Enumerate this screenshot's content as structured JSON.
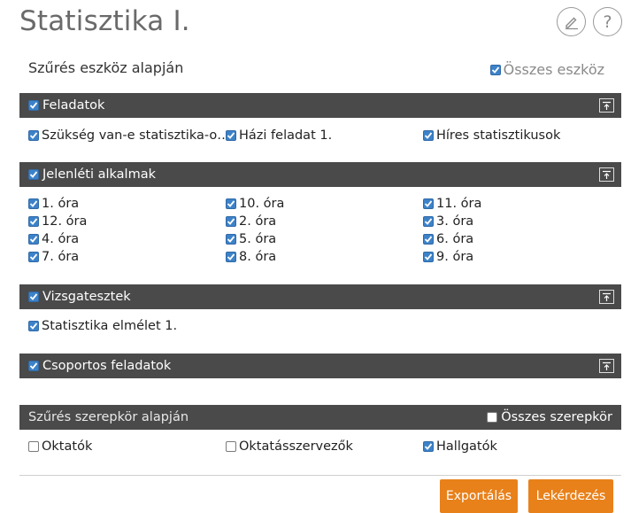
{
  "header": {
    "title": "Statisztika I."
  },
  "filter": {
    "title": "Szűrés eszköz alapján",
    "all_tools_label": "Összes eszköz"
  },
  "sections": {
    "feladatok": {
      "title": "Feladatok",
      "items": [
        "Szükség van-e statisztika-o…",
        "Házi feladat 1.",
        "Híres statisztikusok"
      ]
    },
    "jelenleti": {
      "title": "Jelenléti alkalmak",
      "items": [
        "1. óra",
        "10. óra",
        "11. óra",
        "12. óra",
        "2. óra",
        "3. óra",
        "4. óra",
        "5. óra",
        "6. óra",
        "7. óra",
        "8. óra",
        "9. óra"
      ]
    },
    "vizsgatesztek": {
      "title": "Vizsgatesztek",
      "items": [
        "Statisztika elmélet 1."
      ]
    },
    "csoportos": {
      "title": "Csoportos feladatok"
    }
  },
  "roles": {
    "title": "Szűrés szerepkör alapján",
    "all_roles_label": "Összes szerepkör",
    "items": [
      "Oktatók",
      "Oktatásszervezők",
      "Hallgatók"
    ]
  },
  "actions": {
    "export_label": "Exportálás",
    "query_label": "Lekérdezés"
  },
  "colors": {
    "accent": "#e8811a",
    "bar": "#4a4a4a",
    "checkbox": "#3d82c8"
  },
  "icons": {
    "edit": "pencil-icon",
    "help": "question-icon",
    "collapse": "collapse-up-icon"
  }
}
